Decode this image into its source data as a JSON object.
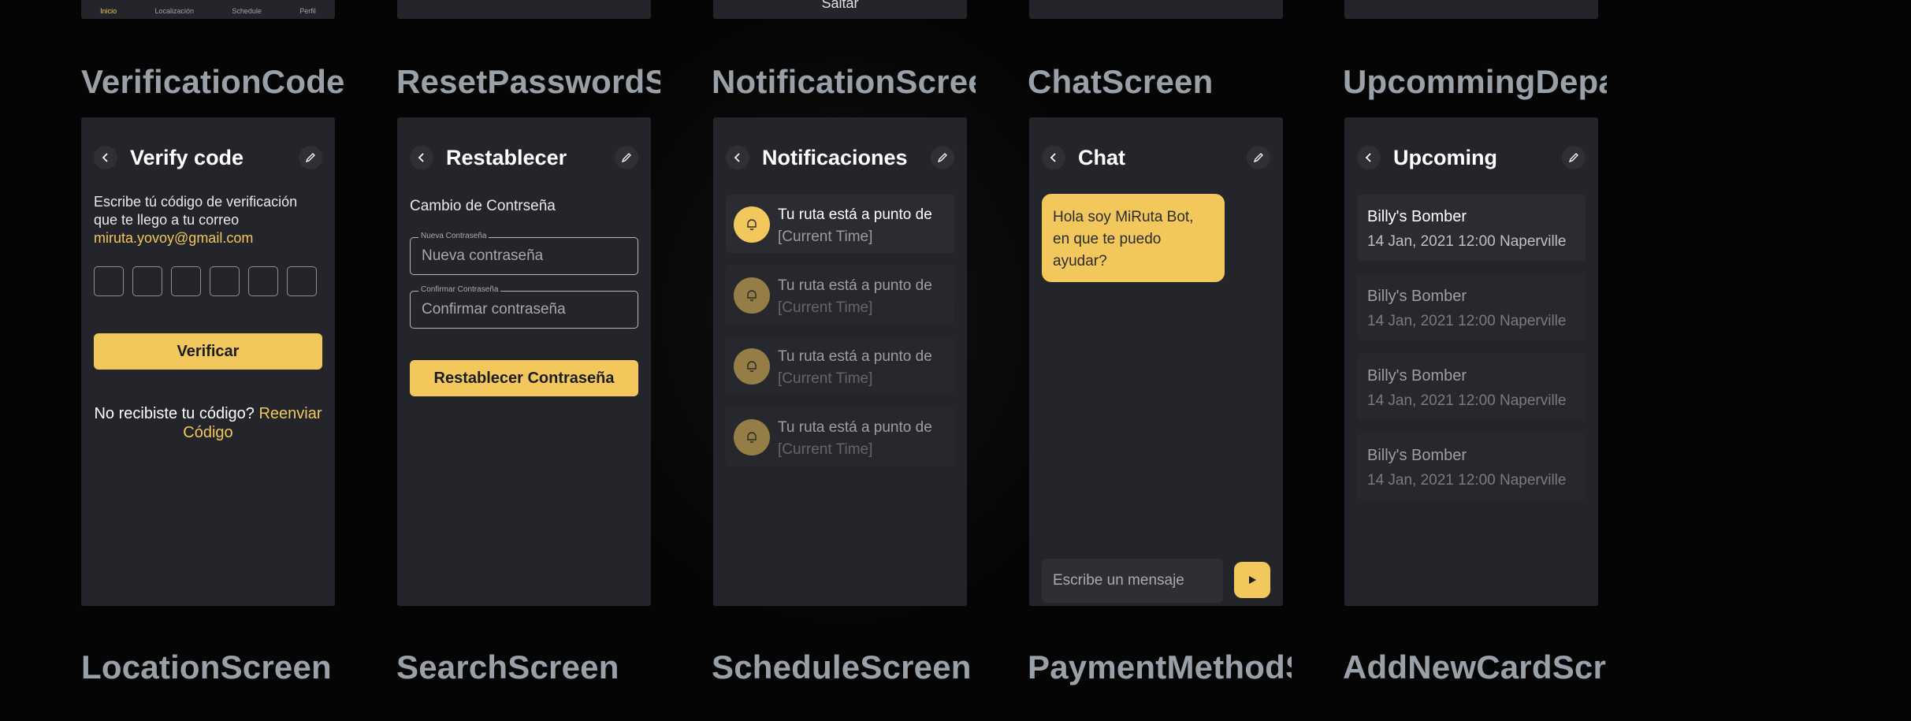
{
  "colors": {
    "background": "#050505",
    "frame": "#24252a",
    "accent": "#f2c75c",
    "title": "#9aa0a8"
  },
  "top_stubs": {
    "nav_items": [
      "Inicio",
      "Localización",
      "Schedule",
      "Perfil"
    ],
    "skip_label": "Saltar"
  },
  "screen_titles": {
    "verification": "VerificationCodeScreen",
    "reset": "ResetPasswordScreen",
    "notification": "NotificationScreen",
    "chat": "ChatScreen",
    "upcoming": "UpcommingDepartures"
  },
  "bottom_titles": {
    "location": "LocationScreen",
    "search": "SearchScreen",
    "schedule": "ScheduleScreen",
    "payment": "PaymentMethodScreen",
    "addcard": "AddNewCardScreen"
  },
  "verify": {
    "title": "Verify code",
    "desc": "Escribe tú código de verificación que te llego a tu correo ",
    "email": "miruta.yovoy@gmail.com",
    "button": "Verificar",
    "resend_prefix": "No recibiste tu código? ",
    "resend_link": "Reenviar Código",
    "icons": {
      "back": "chevron-left-icon",
      "edit": "pencil-icon"
    }
  },
  "reset": {
    "title": "Restablecer",
    "section": "Cambio de Contrseña",
    "new_label": "Nueva Contraseña",
    "new_placeholder": "Nueva contraseña",
    "confirm_label": "Confirmar Contraseña",
    "confirm_placeholder": "Confirmar contraseña",
    "button": "Restablecer Contraseña"
  },
  "notifications": {
    "title": "Notificaciones",
    "items": [
      {
        "text": "Tu ruta está a punto de",
        "time": "[Current Time]"
      },
      {
        "text": "Tu ruta está a punto de",
        "time": "[Current Time]"
      },
      {
        "text": "Tu ruta está a punto de",
        "time": "[Current Time]"
      },
      {
        "text": "Tu ruta está a punto de",
        "time": "[Current Time]"
      }
    ],
    "icon": "bell-icon"
  },
  "chat": {
    "title": "Chat",
    "bot_message": "Hola soy MiRuta Bot, en que te puedo ayudar?",
    "input_placeholder": "Escribe un mensaje",
    "send_icon": "play-send-icon"
  },
  "upcoming": {
    "title": "Upcoming",
    "items": [
      {
        "name": "Billy's Bomber",
        "meta": "14 Jan, 2021 12:00  Naperville"
      },
      {
        "name": "Billy's Bomber",
        "meta": "14 Jan, 2021 12:00  Naperville"
      },
      {
        "name": "Billy's Bomber",
        "meta": "14 Jan, 2021 12:00  Naperville"
      },
      {
        "name": "Billy's Bomber",
        "meta": "14 Jan, 2021 12:00  Naperville"
      }
    ]
  }
}
